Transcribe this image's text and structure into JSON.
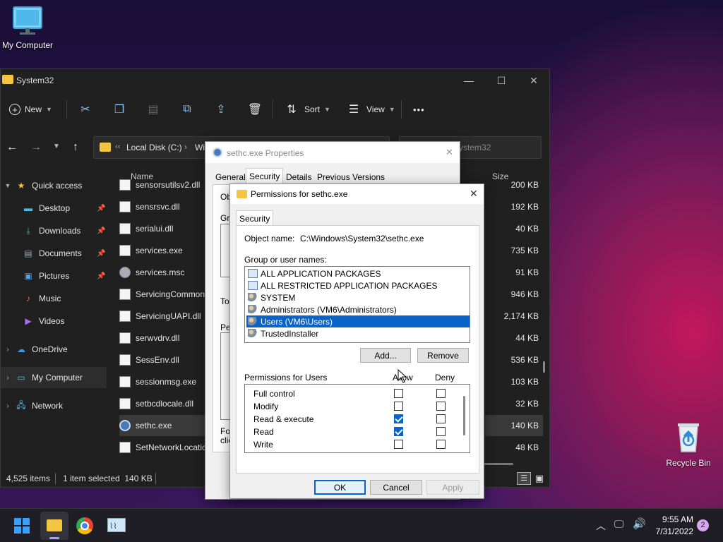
{
  "desktop": {
    "my_computer_label": "My Computer",
    "recycle_bin_label": "Recycle Bin"
  },
  "explorer": {
    "title": "System32",
    "window_controls": {
      "minimize": "—",
      "maximize": "☐",
      "close": "✕"
    },
    "toolbar": {
      "new_label": "New",
      "sort_label": "Sort",
      "view_label": "View",
      "more_label": "•••"
    },
    "address": {
      "drive": "Local Disk (C:)",
      "next_crumb": "Wi",
      "search_placeholder": "ystem32"
    },
    "column_name": "Name",
    "column_size": "Size",
    "nav": {
      "quick_access": "Quick access",
      "desktop": "Desktop",
      "downloads": "Downloads",
      "documents": "Documents",
      "pictures": "Pictures",
      "music": "Music",
      "videos": "Videos",
      "onedrive": "OneDrive",
      "my_computer": "My Computer",
      "network": "Network"
    },
    "files": [
      {
        "name": "sensorsutilsv2.dll",
        "size": "200 KB"
      },
      {
        "name": "sensrsvc.dll",
        "size": "192 KB"
      },
      {
        "name": "serialui.dll",
        "size": "40 KB"
      },
      {
        "name": "services.exe",
        "size": "735 KB"
      },
      {
        "name": "services.msc",
        "size": "91 KB"
      },
      {
        "name": "ServicingCommon",
        "size": "946 KB"
      },
      {
        "name": "ServicingUAPI.dll",
        "size": "2,174 KB"
      },
      {
        "name": "serwvdrv.dll",
        "size": "44 KB"
      },
      {
        "name": "SessEnv.dll",
        "size": "536 KB"
      },
      {
        "name": "sessionmsg.exe",
        "size": "103 KB"
      },
      {
        "name": "setbcdlocale.dll",
        "size": "32 KB"
      },
      {
        "name": "sethc.exe",
        "size": "140 KB"
      },
      {
        "name": "SetNetworkLocatio",
        "size": "48 KB"
      }
    ],
    "status": {
      "items": "4,525 items",
      "selected": "1 item selected  140 KB"
    }
  },
  "properties": {
    "title": "sethc.exe Properties",
    "tabs": {
      "general": "General",
      "security": "Security",
      "details": "Details",
      "previous": "Previous Versions"
    },
    "fragments": {
      "ob": "Ob",
      "gro": "Gro",
      "to": "To",
      "pe": "Pe",
      "fo": "Fo",
      "cli": "clic"
    }
  },
  "permissions": {
    "title": "Permissions for sethc.exe",
    "tab_security": "Security",
    "object_name_label": "Object name:",
    "object_name_value": "C:\\Windows\\System32\\sethc.exe",
    "group_label": "Group or user names:",
    "users": [
      "ALL APPLICATION PACKAGES",
      "ALL RESTRICTED APPLICATION PACKAGES",
      "SYSTEM",
      "Administrators (VM6\\Administrators)",
      "Users (VM6\\Users)",
      "TrustedInstaller"
    ],
    "add_label": "Add...",
    "remove_label": "Remove",
    "perm_header": "Permissions for Users",
    "allow_header": "Allow",
    "deny_header": "Deny",
    "perms": [
      "Full control",
      "Modify",
      "Read & execute",
      "Read",
      "Write"
    ],
    "ok_label": "OK",
    "cancel_label": "Cancel",
    "apply_label": "Apply",
    "close_glyph": "✕"
  },
  "taskbar": {
    "time": "9:55 AM",
    "date": "7/31/2022",
    "notification_count": "2"
  },
  "colors": {
    "accent": "#0a64c8",
    "selection": "#0a64c8"
  }
}
